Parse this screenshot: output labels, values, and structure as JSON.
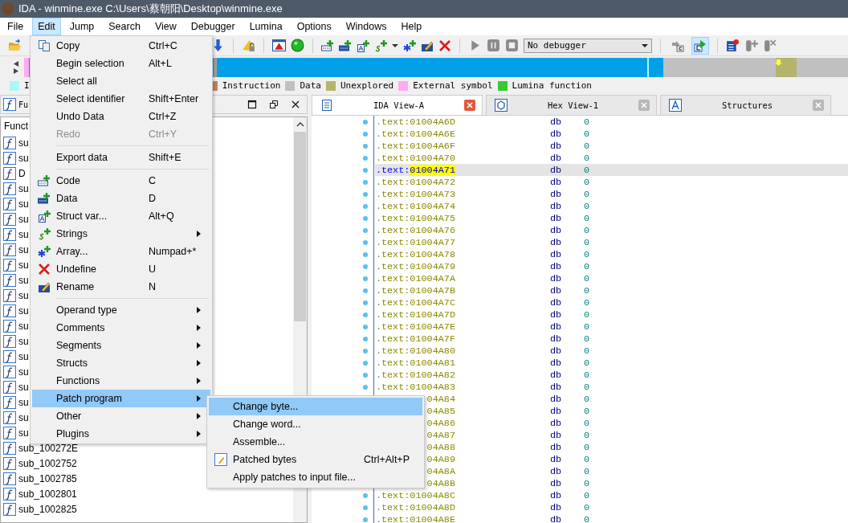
{
  "window": {
    "title": "IDA - winmine.exe C:\\Users\\蔡朝阳\\Desktop\\winmine.exe"
  },
  "menubar": [
    {
      "label": "File",
      "selected": false
    },
    {
      "label": "Edit",
      "selected": true
    },
    {
      "label": "Jump",
      "selected": false
    },
    {
      "label": "Search",
      "selected": false
    },
    {
      "label": "View",
      "selected": false
    },
    {
      "label": "Debugger",
      "selected": false
    },
    {
      "label": "Lumina",
      "selected": false
    },
    {
      "label": "Options",
      "selected": false
    },
    {
      "label": "Windows",
      "selected": false
    },
    {
      "label": "Help",
      "selected": false
    }
  ],
  "toolbar": {
    "debugger_select": "No debugger",
    "toggles": [
      {
        "pressed": false
      },
      {
        "pressed": true
      }
    ]
  },
  "legend": [
    {
      "label": "I",
      "color": "#aaf8f8"
    },
    {
      "label": "Instruction",
      "color": "#c8805a"
    },
    {
      "label": "Data",
      "color": "#c0c0c0"
    },
    {
      "label": "Unexplored",
      "color": "#b4b46e"
    },
    {
      "label": "External symbol",
      "color": "#ffaaf0"
    },
    {
      "label": "Lumina function",
      "color": "#33cc33"
    }
  ],
  "functions_pane": {
    "title": "Fu",
    "column": "Funct",
    "rows": [
      "su",
      "su",
      "D",
      "su",
      "su",
      "su",
      "su",
      "su",
      "su",
      "su",
      "su",
      "su",
      "su",
      "su",
      "su",
      "su",
      "su",
      "su",
      "su",
      "su",
      "sub_100272E",
      "sub_1002752",
      "sub_1002785",
      "sub_1002801",
      "sub_1002825"
    ]
  },
  "tabs": [
    {
      "label": "IDA View-A",
      "selected": true
    },
    {
      "label": "Hex View-1",
      "selected": false
    },
    {
      "label": "Structures",
      "selected": false
    }
  ],
  "listing": [
    {
      "segment": ".text:",
      "offset": "01004A6D",
      "mnemonic": "db",
      "operand": "0",
      "selected": false
    },
    {
      "segment": ".text:",
      "offset": "01004A6E",
      "mnemonic": "db",
      "operand": "0",
      "selected": false
    },
    {
      "segment": ".text:",
      "offset": "01004A6F",
      "mnemonic": "db",
      "operand": "0",
      "selected": false
    },
    {
      "segment": ".text:",
      "offset": "01004A70",
      "mnemonic": "db",
      "operand": "0",
      "selected": false
    },
    {
      "segment": ".text:",
      "offset": "01004A71",
      "mnemonic": "db",
      "operand": "0",
      "selected": true
    },
    {
      "segment": ".text:",
      "offset": "01004A72",
      "mnemonic": "db",
      "operand": "0",
      "selected": false
    },
    {
      "segment": ".text:",
      "offset": "01004A73",
      "mnemonic": "db",
      "operand": "0",
      "selected": false
    },
    {
      "segment": ".text:",
      "offset": "01004A74",
      "mnemonic": "db",
      "operand": "0",
      "selected": false
    },
    {
      "segment": ".text:",
      "offset": "01004A75",
      "mnemonic": "db",
      "operand": "0",
      "selected": false
    },
    {
      "segment": ".text:",
      "offset": "01004A76",
      "mnemonic": "db",
      "operand": "0",
      "selected": false
    },
    {
      "segment": ".text:",
      "offset": "01004A77",
      "mnemonic": "db",
      "operand": "0",
      "selected": false
    },
    {
      "segment": ".text:",
      "offset": "01004A78",
      "mnemonic": "db",
      "operand": "0",
      "selected": false
    },
    {
      "segment": ".text:",
      "offset": "01004A79",
      "mnemonic": "db",
      "operand": "0",
      "selected": false
    },
    {
      "segment": ".text:",
      "offset": "01004A7A",
      "mnemonic": "db",
      "operand": "0",
      "selected": false
    },
    {
      "segment": ".text:",
      "offset": "01004A7B",
      "mnemonic": "db",
      "operand": "0",
      "selected": false
    },
    {
      "segment": ".text:",
      "offset": "01004A7C",
      "mnemonic": "db",
      "operand": "0",
      "selected": false
    },
    {
      "segment": ".text:",
      "offset": "01004A7D",
      "mnemonic": "db",
      "operand": "0",
      "selected": false
    },
    {
      "segment": ".text:",
      "offset": "01004A7E",
      "mnemonic": "db",
      "operand": "0",
      "selected": false
    },
    {
      "segment": ".text:",
      "offset": "01004A7F",
      "mnemonic": "db",
      "operand": "0",
      "selected": false
    },
    {
      "segment": ".text:",
      "offset": "01004A80",
      "mnemonic": "db",
      "operand": "0",
      "selected": false
    },
    {
      "segment": ".text:",
      "offset": "01004A81",
      "mnemonic": "db",
      "operand": "0",
      "selected": false
    },
    {
      "segment": ".text:",
      "offset": "01004A82",
      "mnemonic": "db",
      "operand": "0",
      "selected": false
    },
    {
      "segment": ".text:",
      "offset": "01004A83",
      "mnemonic": "db",
      "operand": "0",
      "selected": false
    },
    {
      "offset": "04A84",
      "mnemonic": "db",
      "operand": "0",
      "selected": false
    },
    {
      "offset": "04A85",
      "mnemonic": "db",
      "operand": "0",
      "selected": false
    },
    {
      "offset": "04A86",
      "mnemonic": "db",
      "operand": "0",
      "selected": false
    },
    {
      "offset": "04A87",
      "mnemonic": "db",
      "operand": "0",
      "selected": false
    },
    {
      "offset": "04A88",
      "mnemonic": "db",
      "operand": "0",
      "selected": false
    },
    {
      "offset": "04A89",
      "mnemonic": "db",
      "operand": "0",
      "selected": false
    },
    {
      "offset": "04A8A",
      "mnemonic": "db",
      "operand": "0",
      "selected": false
    },
    {
      "offset": "04A8B",
      "mnemonic": "db",
      "operand": "0",
      "selected": false
    },
    {
      "segment": ".text:",
      "offset": "01004A8C",
      "mnemonic": "db",
      "operand": "0",
      "selected": false
    },
    {
      "segment": ".text:",
      "offset": "01004A8D",
      "mnemonic": "db",
      "operand": "0",
      "selected": false
    },
    {
      "segment": ".text:",
      "offset": "01004A8E",
      "mnemonic": "db",
      "operand": "0",
      "selected": false
    }
  ],
  "edit_menu": [
    {
      "kind": "item",
      "label": "Copy",
      "shortcut": "Ctrl+C",
      "disabled": false,
      "submenu": false,
      "selected": false
    },
    {
      "kind": "item",
      "label": "Begin selection",
      "shortcut": "Alt+L",
      "disabled": false,
      "submenu": false,
      "selected": false
    },
    {
      "kind": "item",
      "label": "Select all",
      "disabled": false,
      "submenu": false,
      "selected": false
    },
    {
      "kind": "item",
      "label": "Select identifier",
      "shortcut": "Shift+Enter",
      "disabled": false,
      "submenu": false,
      "selected": false
    },
    {
      "kind": "item",
      "label": "Undo Data",
      "shortcut": "Ctrl+Z",
      "disabled": false,
      "submenu": false,
      "selected": false
    },
    {
      "kind": "item",
      "label": "Redo",
      "shortcut": "Ctrl+Y",
      "disabled": true,
      "submenu": false,
      "selected": false
    },
    {
      "kind": "separator"
    },
    {
      "kind": "item",
      "label": "Export data",
      "shortcut": "Shift+E",
      "disabled": false,
      "submenu": false,
      "selected": false
    },
    {
      "kind": "separator"
    },
    {
      "kind": "item",
      "label": "Code",
      "shortcut": "C",
      "disabled": false,
      "submenu": false,
      "selected": false
    },
    {
      "kind": "item",
      "label": "Data",
      "shortcut": "D",
      "disabled": false,
      "submenu": false,
      "selected": false
    },
    {
      "kind": "item",
      "label": "Struct var...",
      "shortcut": "Alt+Q",
      "disabled": false,
      "submenu": false,
      "selected": false
    },
    {
      "kind": "item",
      "label": "Strings",
      "disabled": false,
      "submenu": true,
      "selected": false
    },
    {
      "kind": "item",
      "label": "Array...",
      "shortcut": "Numpad+*",
      "disabled": false,
      "submenu": false,
      "selected": false
    },
    {
      "kind": "item",
      "label": "Undefine",
      "shortcut": "U",
      "disabled": false,
      "submenu": false,
      "selected": false
    },
    {
      "kind": "item",
      "label": "Rename",
      "shortcut": "N",
      "disabled": false,
      "submenu": false,
      "selected": false
    },
    {
      "kind": "separator"
    },
    {
      "kind": "item",
      "label": "Operand type",
      "disabled": false,
      "submenu": true,
      "selected": false
    },
    {
      "kind": "item",
      "label": "Comments",
      "disabled": false,
      "submenu": true,
      "selected": false
    },
    {
      "kind": "item",
      "label": "Segments",
      "disabled": false,
      "submenu": true,
      "selected": false
    },
    {
      "kind": "item",
      "label": "Structs",
      "disabled": false,
      "submenu": true,
      "selected": false
    },
    {
      "kind": "item",
      "label": "Functions",
      "disabled": false,
      "submenu": true,
      "selected": false
    },
    {
      "kind": "item",
      "label": "Patch program",
      "disabled": false,
      "submenu": true,
      "selected": true
    },
    {
      "kind": "item",
      "label": "Other",
      "disabled": false,
      "submenu": true,
      "selected": false
    },
    {
      "kind": "item",
      "label": "Plugins",
      "disabled": false,
      "submenu": true,
      "selected": false
    }
  ],
  "patch_submenu": [
    {
      "label": "Change byte...",
      "selected": true
    },
    {
      "label": "Change word...",
      "selected": false
    },
    {
      "label": "Assemble...",
      "selected": false
    },
    {
      "label": "Patched bytes",
      "shortcut": "Ctrl+Alt+P",
      "selected": false
    },
    {
      "label": "Apply patches to input file...",
      "selected": false
    }
  ]
}
